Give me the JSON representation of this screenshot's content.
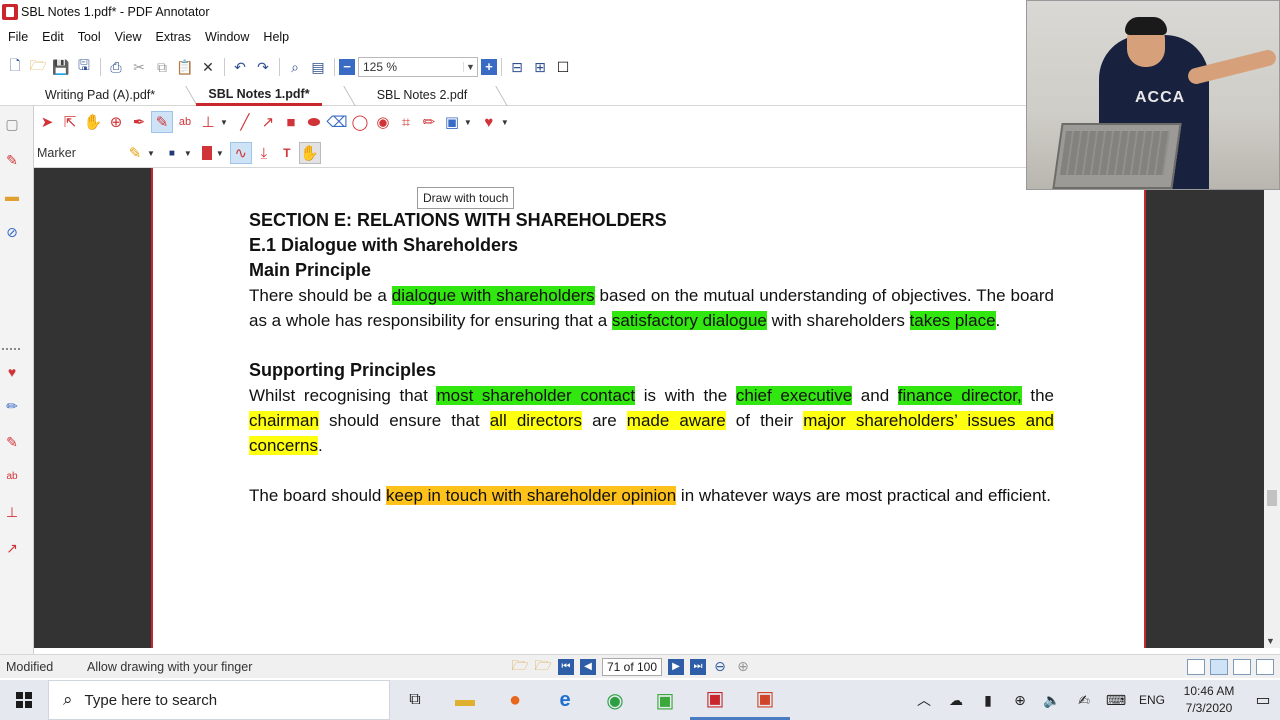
{
  "window": {
    "title": "SBL Notes 1.pdf* - PDF Annotator"
  },
  "menu": [
    "File",
    "Edit",
    "Tool",
    "View",
    "Extras",
    "Window",
    "Help"
  ],
  "toolbar": {
    "zoom_value": "125 %"
  },
  "tabs": [
    {
      "label": "Writing Pad (A).pdf*",
      "active": false
    },
    {
      "label": "SBL Notes 1.pdf*",
      "active": true
    },
    {
      "label": "SBL Notes 2.pdf",
      "active": false
    }
  ],
  "ribbon": {
    "tool_label": "Marker"
  },
  "tooltip": {
    "text": "Draw with touch"
  },
  "document": {
    "section_title": "SECTION E: RELATIONS WITH SHAREHOLDERS",
    "subsection_title": "E.1 Dialogue with Shareholders",
    "main_principle_heading": "Main Principle",
    "p1": {
      "t1": "There should be a ",
      "h1": "dialogue with shareholders",
      "t2": " based on the mutual understanding of objectives. The board as a whole has responsibility for ensuring that a ",
      "h2": "satisfactory dialogue",
      "t3": " with shareholders ",
      "h3": "takes place",
      "t4": "."
    },
    "supporting_heading": "Supporting Principles",
    "p2": {
      "t1": "Whilst recognising that ",
      "h1": "most shareholder contact",
      "t2": " is with the ",
      "h2": "chief executive",
      "t3": " and ",
      "h3": "finance director,",
      "t4": " the ",
      "h4": "chairman",
      "t5": " should ensure that ",
      "h5": "all directors",
      "t6": " are ",
      "h6": "made aware",
      "t7": " of their ",
      "h7": "major shareholders’ issues and concerns",
      "t8": "."
    },
    "p3": {
      "t1": "The board should ",
      "h1": "keep in touch with shareholder opinion",
      "t2": " in whatever ways are most practical and efficient."
    },
    "highlight_colors": {
      "green": "#32e610",
      "yellow": "#ffff10",
      "orange": "#ffc21a"
    }
  },
  "status": {
    "left": "Modified",
    "hint": "Allow drawing with your finger",
    "page_indicator": "71 of 100"
  },
  "taskbar": {
    "search_placeholder": "Type here to search",
    "language": "ENG",
    "time": "10:46 AM",
    "date": "7/3/2020"
  },
  "webcam": {
    "shirt_text": "ACCA"
  },
  "colors": {
    "accent": "#c8282d",
    "doc_background": "#333333",
    "nav_blue": "#2f5ea8"
  }
}
